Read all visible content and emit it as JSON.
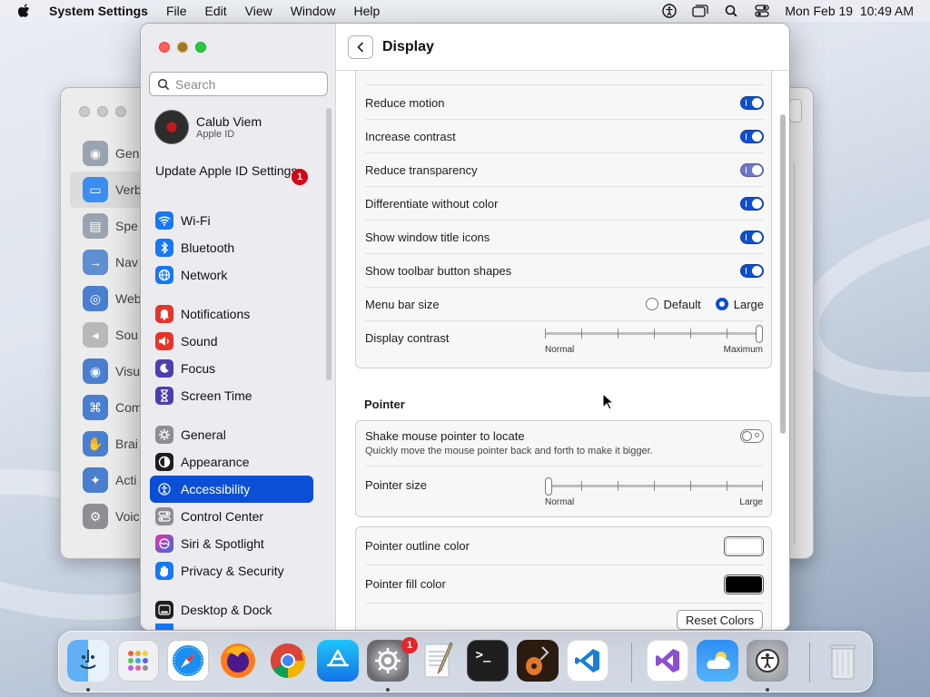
{
  "menubar": {
    "app_name": "System Settings",
    "menus": [
      "File",
      "Edit",
      "View",
      "Window",
      "Help"
    ],
    "clock": "Mon Feb 19  10:49 AM",
    "status_icons": [
      "accessibility-icon",
      "window-icon",
      "search-icon",
      "control-center-icon"
    ]
  },
  "background_window": {
    "items": [
      {
        "label": "Gen",
        "icon": "hearing-icon"
      },
      {
        "label": "Verb",
        "icon": "speech-bubble-icon"
      },
      {
        "label": "Spe",
        "icon": "speech-icon"
      },
      {
        "label": "Nav",
        "icon": "navigation-icon"
      },
      {
        "label": "Web",
        "icon": "web-icon"
      },
      {
        "label": "Sou",
        "icon": "sound-icon"
      },
      {
        "label": "Visu",
        "icon": "eye-icon"
      },
      {
        "label": "Com",
        "icon": "command-icon"
      },
      {
        "label": "Brai",
        "icon": "hand-icon"
      },
      {
        "label": "Acti",
        "icon": "activities-icon"
      },
      {
        "label": "Voic",
        "icon": "voice-control-icon"
      }
    ]
  },
  "sidebar": {
    "search_placeholder": "Search",
    "profile": {
      "name": "Calub Viem",
      "subtitle": "Apple ID"
    },
    "update": {
      "label": "Update Apple ID Settings",
      "badge": "1"
    },
    "items": [
      {
        "label": "Wi-Fi",
        "icon": "wifi-icon",
        "color": "#1877f2"
      },
      {
        "label": "Bluetooth",
        "icon": "bluetooth-icon",
        "color": "#1877f2"
      },
      {
        "label": "Network",
        "icon": "globe-icon",
        "color": "#1877f2"
      },
      {
        "label": "Notifications",
        "icon": "bell-icon",
        "color": "#e5352b"
      },
      {
        "label": "Sound",
        "icon": "speaker-icon",
        "color": "#e5352b"
      },
      {
        "label": "Focus",
        "icon": "moon-icon",
        "color": "#4b3fb0"
      },
      {
        "label": "Screen Time",
        "icon": "hourglass-icon",
        "color": "#4b3fb0"
      },
      {
        "label": "General",
        "icon": "gear-icon",
        "color": "#8e8e93"
      },
      {
        "label": "Appearance",
        "icon": "appearance-icon",
        "color": "#1d1d1f"
      },
      {
        "label": "Accessibility",
        "icon": "accessibility-icon",
        "color": "#0a4fd6"
      },
      {
        "label": "Control Center",
        "icon": "toggles-icon",
        "color": "#8e8e93"
      },
      {
        "label": "Siri & Spotlight",
        "icon": "siri-icon",
        "color": "#b03ab8"
      },
      {
        "label": "Privacy & Security",
        "icon": "hand-icon",
        "color": "#1877f2"
      },
      {
        "label": "Desktop & Dock",
        "icon": "dock-icon",
        "color": "#1d1d1f"
      }
    ],
    "selected": "Accessibility"
  },
  "content": {
    "title": "Display",
    "display_settings": {
      "toggles": [
        {
          "label": "Reduce motion",
          "state": "on"
        },
        {
          "label": "Increase contrast",
          "state": "on"
        },
        {
          "label": "Reduce transparency",
          "state": "on-dim"
        },
        {
          "label": "Differentiate without color",
          "state": "on"
        },
        {
          "label": "Show window title icons",
          "state": "on"
        },
        {
          "label": "Show toolbar button shapes",
          "state": "on"
        }
      ],
      "menu_bar_size": {
        "label": "Menu bar size",
        "options": [
          "Default",
          "Large"
        ],
        "selected": "Large"
      },
      "display_contrast": {
        "label": "Display contrast",
        "min_label": "Normal",
        "max_label": "Maximum",
        "value": 1.0
      }
    },
    "pointer": {
      "section_title": "Pointer",
      "shake": {
        "label": "Shake mouse pointer to locate",
        "description": "Quickly move the mouse pointer back and forth to make it bigger.",
        "state": "off"
      },
      "size": {
        "label": "Pointer size",
        "min_label": "Normal",
        "max_label": "Large",
        "value": 0.0
      }
    },
    "colors": {
      "outline_label": "Pointer outline color",
      "outline_color": "#ffffff",
      "fill_label": "Pointer fill color",
      "fill_color": "#000000",
      "reset_label": "Reset Colors"
    }
  },
  "dock": {
    "apps": [
      {
        "name": "Finder",
        "icon": "finder-icon",
        "running": true
      },
      {
        "name": "Launchpad",
        "icon": "launchpad-icon",
        "running": false
      },
      {
        "name": "Safari",
        "icon": "safari-icon",
        "running": false
      },
      {
        "name": "Firefox",
        "icon": "firefox-icon",
        "running": false
      },
      {
        "name": "Chrome",
        "icon": "chrome-icon",
        "running": false
      },
      {
        "name": "App Store",
        "icon": "app-store-icon",
        "running": false
      },
      {
        "name": "System Settings",
        "icon": "system-settings-icon",
        "running": true,
        "badge": "1"
      },
      {
        "name": "TextEdit",
        "icon": "textedit-icon",
        "running": false
      },
      {
        "name": "Terminal",
        "icon": "terminal-icon",
        "running": false
      },
      {
        "name": "GarageBand",
        "icon": "garageband-icon",
        "running": false
      },
      {
        "name": "Visual Studio Code",
        "icon": "vscode-icon",
        "running": false
      },
      {
        "name": "Visual Studio",
        "icon": "visual-studio-icon",
        "running": false
      },
      {
        "name": "Weather",
        "icon": "weather-icon",
        "running": false
      },
      {
        "name": "Accessibility Inspector",
        "icon": "accessibility-inspector-icon",
        "running": true
      },
      {
        "name": "Trash",
        "icon": "trash-icon",
        "running": false
      }
    ]
  }
}
